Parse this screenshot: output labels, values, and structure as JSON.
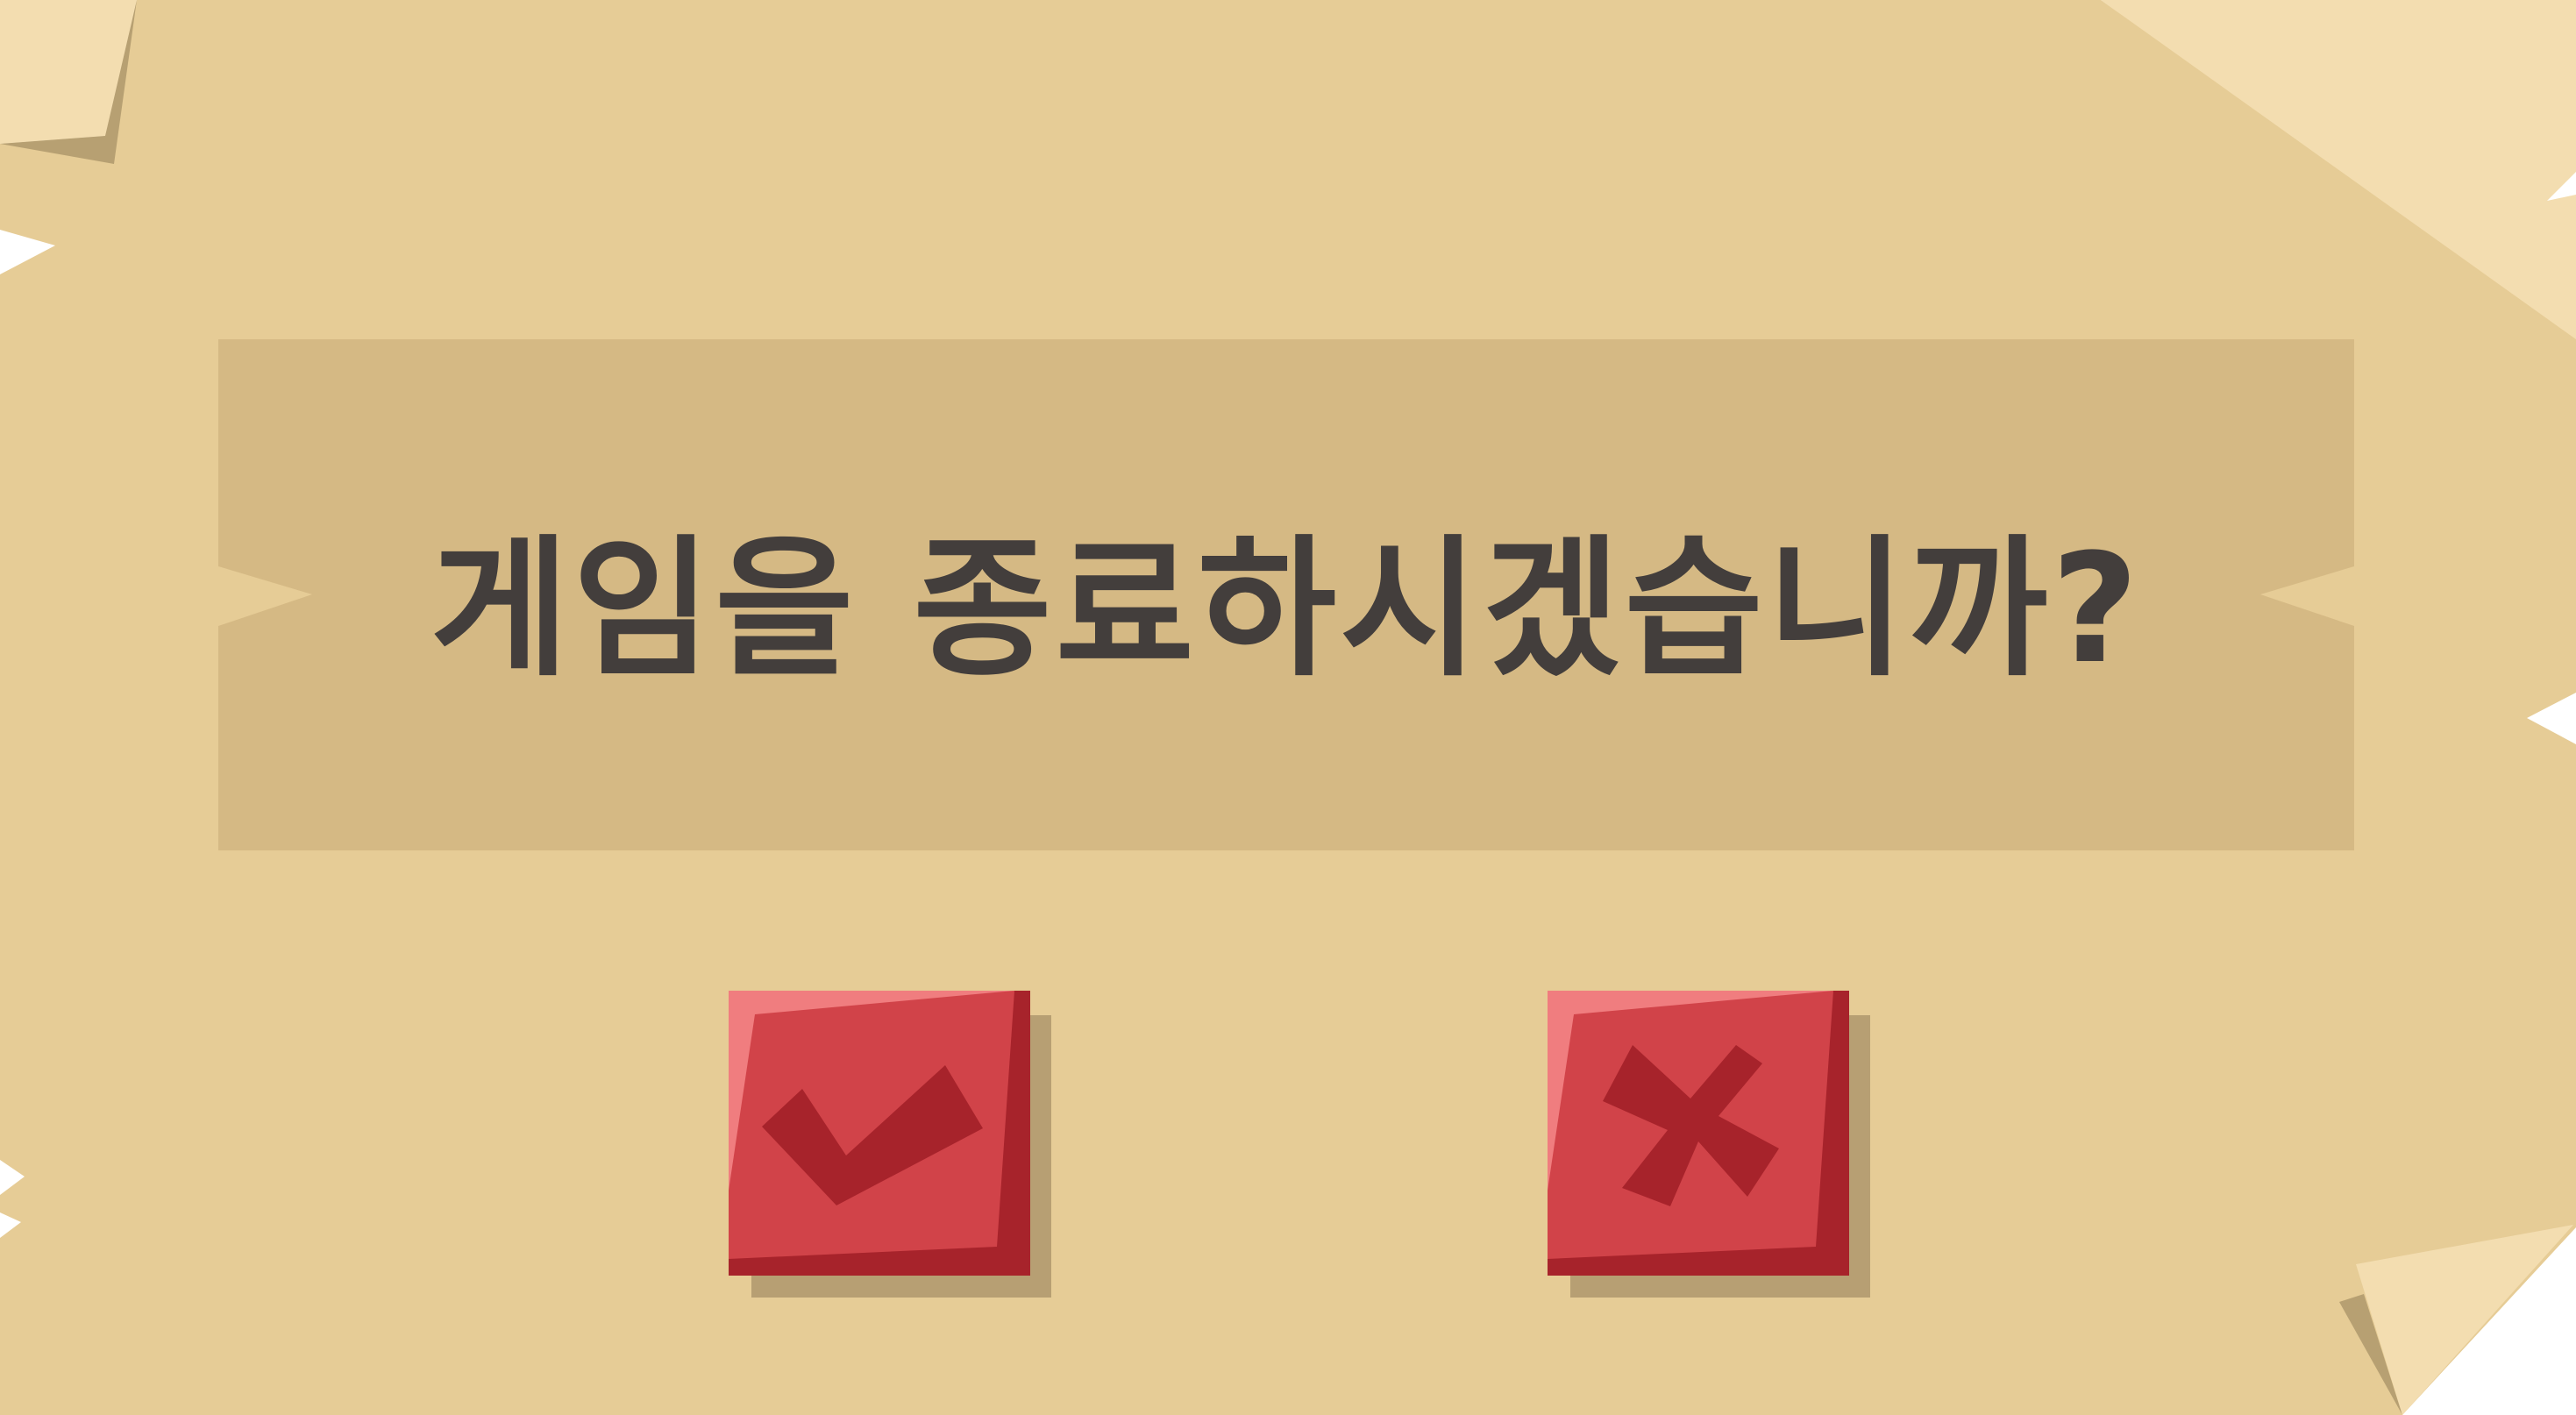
{
  "dialog": {
    "message": "게임을 종료하시겠습니까?",
    "confirm_icon": "checkmark-icon",
    "cancel_icon": "x-mark-icon"
  },
  "colors": {
    "paper": "#e6cc96",
    "paper_light": "#f3ddb0",
    "paper_shadow": "#b7a072",
    "message_panel": "#d5b984",
    "text": "#433e3c",
    "button_red": "#d14349",
    "button_dark_red": "#a7232b",
    "button_highlight": "#f07d7f",
    "button_shadow": "#b79f73"
  }
}
